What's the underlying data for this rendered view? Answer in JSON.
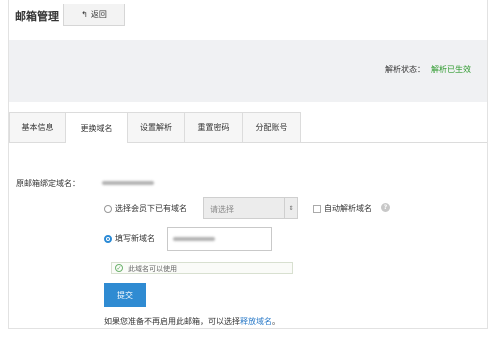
{
  "header": {
    "title": "邮箱管理",
    "back_label": "返回"
  },
  "status": {
    "label": "解析状态：",
    "value": "解析已生效",
    "value_color": "#2e9a2e"
  },
  "tabs": [
    {
      "label": "基本信息",
      "active": false
    },
    {
      "label": "更换域名",
      "active": true
    },
    {
      "label": "设置解析",
      "active": false
    },
    {
      "label": "重置密码",
      "active": false
    },
    {
      "label": "分配账号",
      "active": false
    }
  ],
  "form": {
    "original_domain_label": "原邮箱绑定域名：",
    "option_existing_label": "选择会员下已有域名",
    "option_existing_selected": false,
    "select_placeholder": "请选择",
    "auto_resolve_label": "自动解析域名",
    "auto_resolve_checked": false,
    "option_new_label": "填写新域名",
    "option_new_selected": true,
    "availability_tip": "此域名可以使用",
    "submit_label": "提交"
  },
  "footer": {
    "text_before": "如果您准备不再启用此邮箱，可以选择",
    "link_text": "释放域名",
    "text_after": "。"
  },
  "colors": {
    "accent": "#2f8bd2",
    "link": "#2a7ac8",
    "success": "#2e9a2e"
  }
}
